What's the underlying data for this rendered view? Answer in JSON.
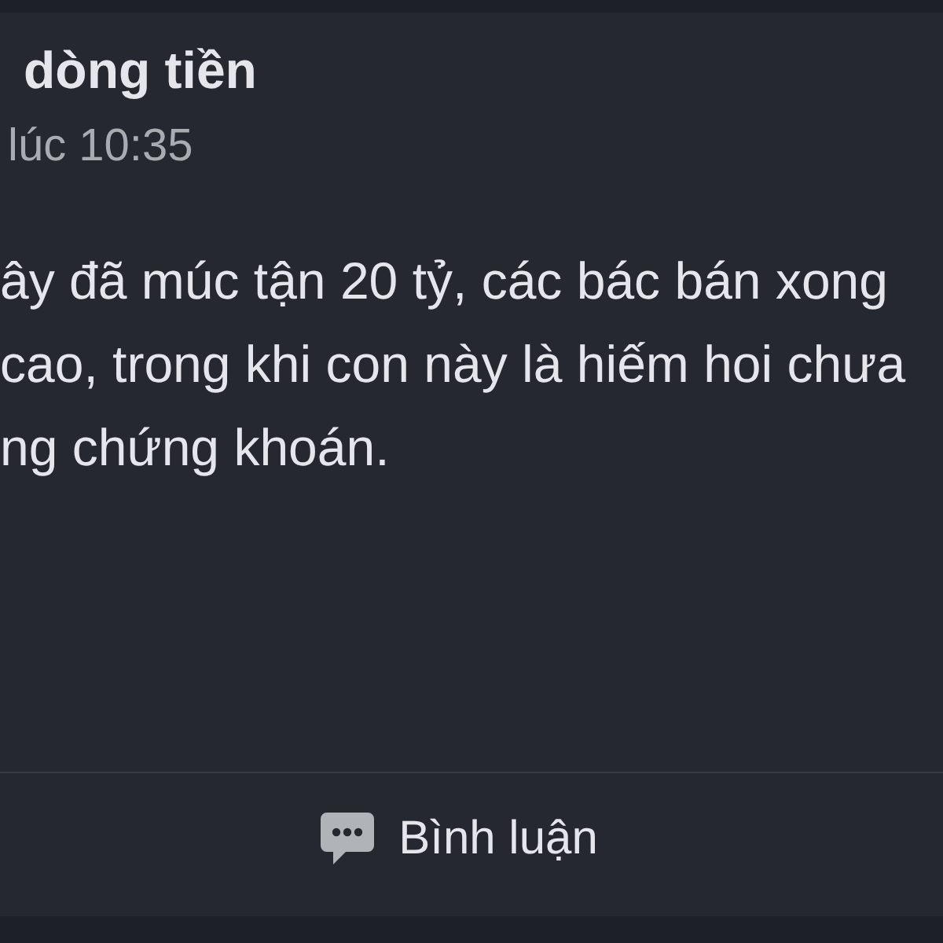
{
  "post": {
    "title": "dòng tiền",
    "timestamp": "lúc 10:35",
    "body_lines": [
      "ây đã múc tận 20 tỷ, các bác bán xong",
      "cao, trong khi con này là hiếm hoi chưa",
      "ng chứng khoán."
    ]
  },
  "actions": [
    {
      "kind": "comment",
      "label": "Bình luận"
    }
  ]
}
